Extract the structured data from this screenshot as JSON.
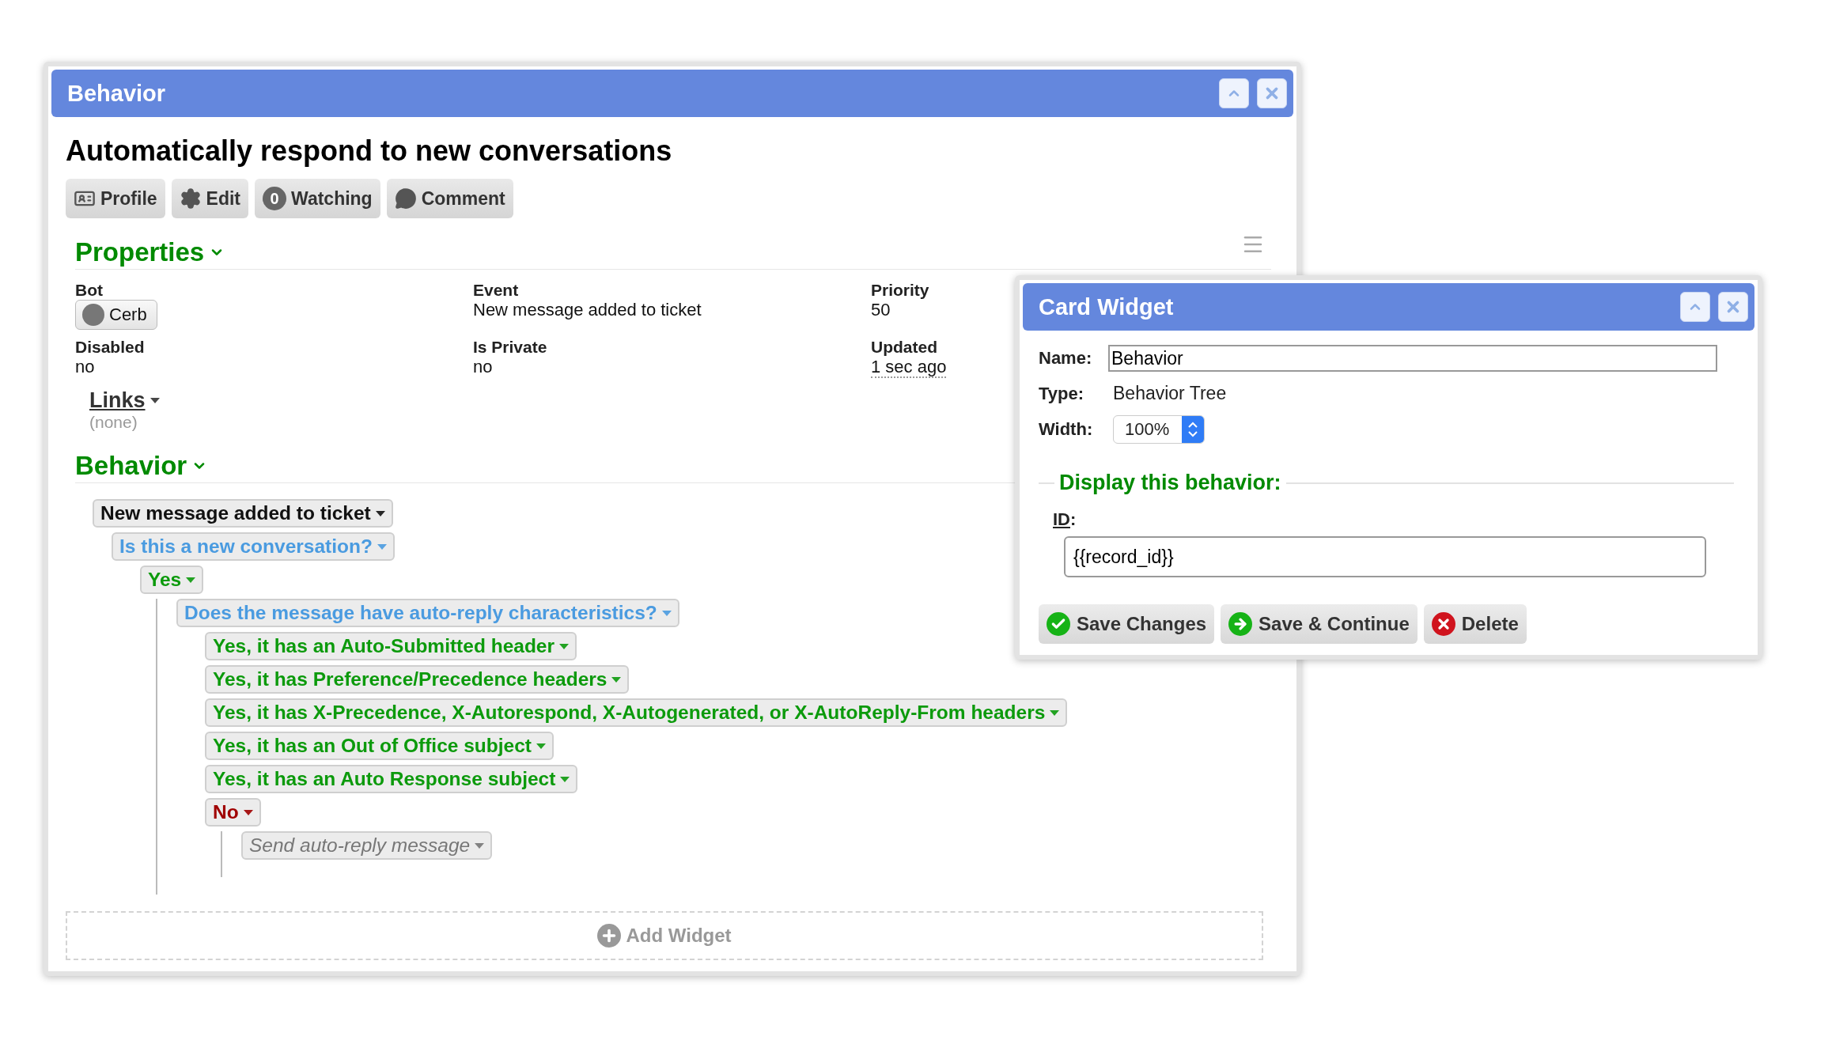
{
  "main_window": {
    "title": "Behavior",
    "heading": "Automatically respond to new conversations",
    "toolbar": [
      {
        "kind": "profile",
        "label": "Profile"
      },
      {
        "kind": "edit",
        "label": "Edit"
      },
      {
        "kind": "watching",
        "count": "0",
        "label": "Watching"
      },
      {
        "kind": "comment",
        "label": "Comment"
      }
    ],
    "properties": {
      "title": "Properties",
      "fields": [
        {
          "label": "Bot",
          "kind": "chip",
          "value": "Cerb"
        },
        {
          "label": "Event",
          "kind": "text",
          "value": "New message added to ticket"
        },
        {
          "label": "Priority",
          "kind": "text",
          "value": "50"
        },
        {
          "label": "Disabled",
          "kind": "text",
          "value": "no"
        },
        {
          "label": "Is Private",
          "kind": "text",
          "value": "no"
        },
        {
          "label": "Updated",
          "kind": "time",
          "value": "1 sec ago"
        }
      ]
    },
    "links": {
      "title": "Links",
      "value": "(none)"
    },
    "behavior": {
      "title": "Behavior",
      "tree": [
        {
          "kind": "event",
          "label": "New message added to ticket",
          "children": [
            {
              "kind": "decision",
              "label": "Is this a new conversation?",
              "children": [
                {
                  "kind": "yes",
                  "label": "Yes",
                  "children": [
                    {
                      "kind": "decision",
                      "label": "Does the message have auto-reply characteristics?",
                      "children": [
                        {
                          "kind": "yes",
                          "label": "Yes, it has an Auto-Submitted header"
                        },
                        {
                          "kind": "yes",
                          "label": "Yes, it has Preference/Precedence headers"
                        },
                        {
                          "kind": "yes",
                          "label": "Yes, it has X-Precedence, X-Autorespond, X-Autogenerated, or X-AutoReply-From headers"
                        },
                        {
                          "kind": "yes",
                          "label": "Yes, it has an Out of Office subject"
                        },
                        {
                          "kind": "yes",
                          "label": "Yes, it has an Auto Response subject"
                        },
                        {
                          "kind": "no",
                          "label": "No",
                          "children": [
                            {
                              "kind": "action",
                              "label": "Send auto-reply message"
                            }
                          ]
                        }
                      ]
                    }
                  ]
                }
              ]
            }
          ]
        }
      ]
    },
    "add_widget": "Add Widget"
  },
  "card_widget": {
    "title": "Card Widget",
    "name_label": "Name:",
    "name_value": "Behavior",
    "type_label": "Type:",
    "type_value": "Behavior Tree",
    "width_label": "Width:",
    "width_value": "100%",
    "section": "Display this behavior:",
    "id_label": "ID",
    "id_suffix": ":",
    "id_value": "{{record_id}}",
    "buttons": [
      {
        "kind": "save",
        "label": "Save Changes"
      },
      {
        "kind": "continue",
        "label": "Save & Continue"
      },
      {
        "kind": "delete",
        "label": "Delete"
      }
    ]
  }
}
